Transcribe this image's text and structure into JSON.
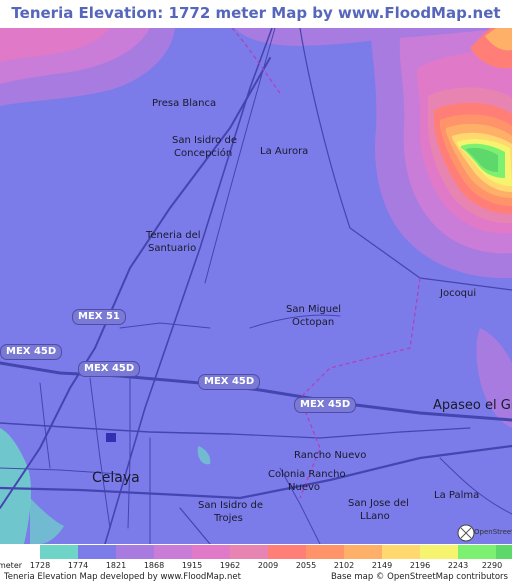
{
  "title": "Teneria Elevation: 1772 meter Map by www.FloodMap.net (beta)",
  "map": {
    "places": [
      {
        "id": "presa-blanca",
        "text": "Presa Blanca"
      },
      {
        "id": "san-isidro-concepcion-1",
        "text": "San Isidro de"
      },
      {
        "id": "san-isidro-concepcion-2",
        "text": "Concepción"
      },
      {
        "id": "la-aurora",
        "text": "La Aurora"
      },
      {
        "id": "teneria-1",
        "text": "Teneria del"
      },
      {
        "id": "teneria-2",
        "text": "Santuario"
      },
      {
        "id": "jocoqui",
        "text": "Jocoqui"
      },
      {
        "id": "san-miguel-1",
        "text": "San Miguel"
      },
      {
        "id": "san-miguel-2",
        "text": "Octopan"
      },
      {
        "id": "apaseo",
        "text": "Apaseo el Gra"
      },
      {
        "id": "rancho-nuevo",
        "text": "Rancho Nuevo"
      },
      {
        "id": "colonia-1",
        "text": "Colonia Rancho"
      },
      {
        "id": "colonia-2",
        "text": "Nuevo"
      },
      {
        "id": "celaya",
        "text": "Celaya"
      },
      {
        "id": "san-isidro-trojes-1",
        "text": "San Isidro de"
      },
      {
        "id": "san-isidro-trojes-2",
        "text": "Trojes"
      },
      {
        "id": "san-jose-1",
        "text": "San Jose del"
      },
      {
        "id": "san-jose-2",
        "text": "LLano"
      },
      {
        "id": "la-palma",
        "text": "La Palma"
      }
    ],
    "highways": [
      "MEX 51",
      "MEX 45D",
      "MEX 45D",
      "MEX 45D",
      "MEX 45D"
    ],
    "osm_badge": "OpenStreetMap"
  },
  "legend": {
    "unit_label": "meter",
    "ticks": [
      "1728",
      "1774",
      "1821",
      "1868",
      "1915",
      "1962",
      "2009",
      "2055",
      "2102",
      "2149",
      "2196",
      "2243",
      "2290"
    ],
    "colors": [
      "#6fd4c8",
      "#7b7bea",
      "#a77be0",
      "#c97cd8",
      "#e07ac8",
      "#e884b2",
      "#ff7f78",
      "#ff946a",
      "#ffb068",
      "#ffd870",
      "#f6f46e",
      "#7cf070",
      "#5ed86a"
    ]
  },
  "footer": {
    "left": "Teneria Elevation Map developed by www.FloodMap.net",
    "right": "Base map © OpenStreetMap contributors"
  }
}
